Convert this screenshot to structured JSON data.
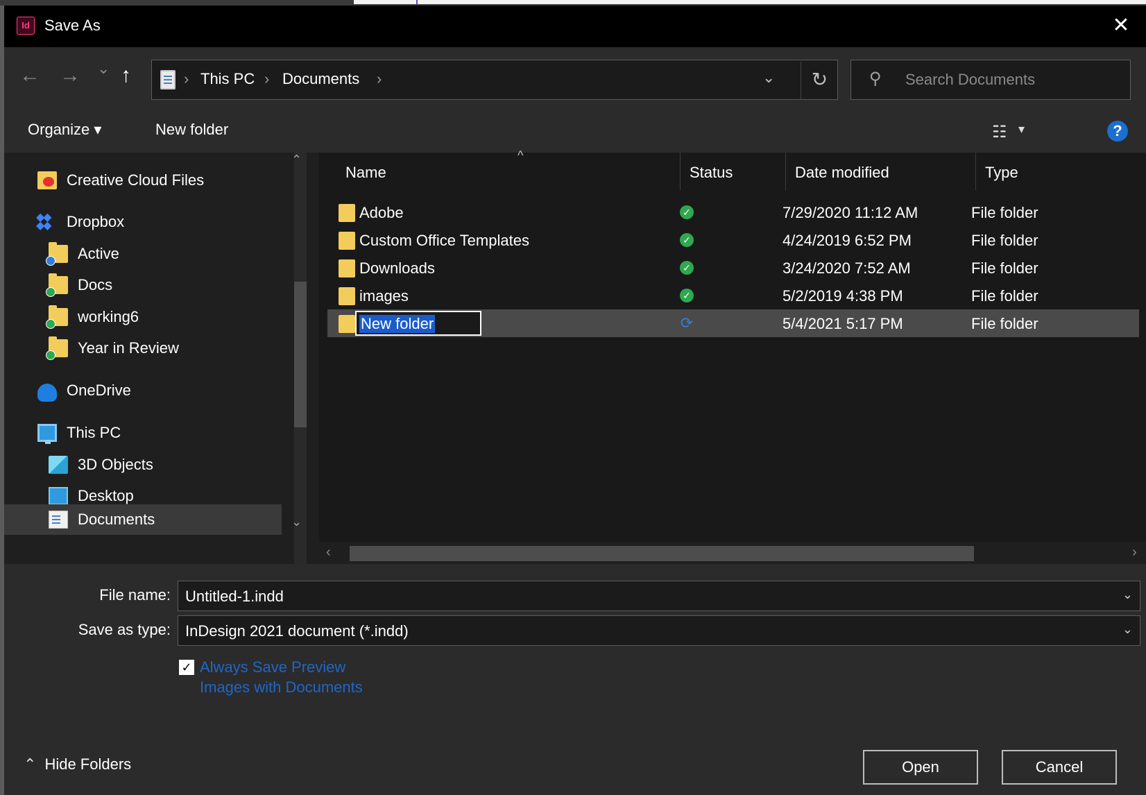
{
  "window": {
    "app_icon_label": "Id",
    "title": "Save As",
    "close_glyph": "✕"
  },
  "nav": {
    "back_glyph": "←",
    "forward_glyph": "→",
    "recent_glyph": "⌄",
    "up_glyph": "↑",
    "breadcrumbs": [
      "This PC",
      "Documents"
    ],
    "sep_glyph": "›",
    "dropdown_glyph": "⌄",
    "refresh_glyph": "↻",
    "search_placeholder": "Search Documents",
    "search_icon": "search-icon"
  },
  "toolbar": {
    "organize_label": "Organize ▾",
    "new_folder_label": "New folder",
    "view_glyph": "☷",
    "view_dd_glyph": "▾",
    "help_glyph": "?"
  },
  "sidebar": {
    "items": [
      {
        "label": "Creative Cloud Files",
        "icon": "creative-cloud-icon"
      },
      {
        "label": "Dropbox",
        "icon": "dropbox-icon"
      },
      {
        "label": "Active",
        "icon": "folder-icon"
      },
      {
        "label": "Docs",
        "icon": "folder-icon"
      },
      {
        "label": "working6",
        "icon": "folder-icon"
      },
      {
        "label": "Year in Review",
        "icon": "folder-icon"
      },
      {
        "label": "OneDrive",
        "icon": "onedrive-icon"
      },
      {
        "label": "This PC",
        "icon": "computer-icon"
      },
      {
        "label": "3D Objects",
        "icon": "cube-icon"
      },
      {
        "label": "Desktop",
        "icon": "desktop-icon"
      },
      {
        "label": "Documents",
        "icon": "documents-icon"
      }
    ],
    "selected": "Documents",
    "scroll_up_glyph": "⌃",
    "scroll_down_glyph": "⌄"
  },
  "files": {
    "columns": [
      "Name",
      "Status",
      "Date modified",
      "Type"
    ],
    "sort_glyph": "^",
    "rows": [
      {
        "name": "Adobe",
        "status": "synced",
        "date": "7/29/2020 11:12 AM",
        "type": "File folder"
      },
      {
        "name": "Custom Office Templates",
        "status": "synced",
        "date": "4/24/2019 6:52 PM",
        "type": "File folder"
      },
      {
        "name": "Downloads",
        "status": "synced",
        "date": "3/24/2020 7:52 AM",
        "type": "File folder"
      },
      {
        "name": "images",
        "status": "synced",
        "date": "5/2/2019 4:38 PM",
        "type": "File folder"
      },
      {
        "name": "New folder",
        "status": "syncing",
        "date": "5/4/2021 5:17 PM",
        "type": "File folder"
      }
    ],
    "status_synced_glyph": "✓",
    "status_syncing_glyph": "⟳",
    "hscroll_left_glyph": "‹",
    "hscroll_right_glyph": "›"
  },
  "form": {
    "file_name_label": "File name:",
    "file_name_value": "Untitled-1.indd",
    "save_type_label": "Save as type:",
    "save_type_value": "InDesign 2021 document (*.indd)",
    "combo_glyph": "⌄",
    "preview_check_glyph": "✓",
    "preview_checked": true,
    "preview_label": "Always Save Preview Images with Documents",
    "hide_folders_caret": "⌃",
    "hide_folders_label": "Hide Folders",
    "open_label": "Open",
    "cancel_label": "Cancel"
  },
  "colors": {
    "accent": "#1a6fd1",
    "folder": "#f3cd5b",
    "synced": "#2fa84f",
    "link": "#1f66c8"
  }
}
